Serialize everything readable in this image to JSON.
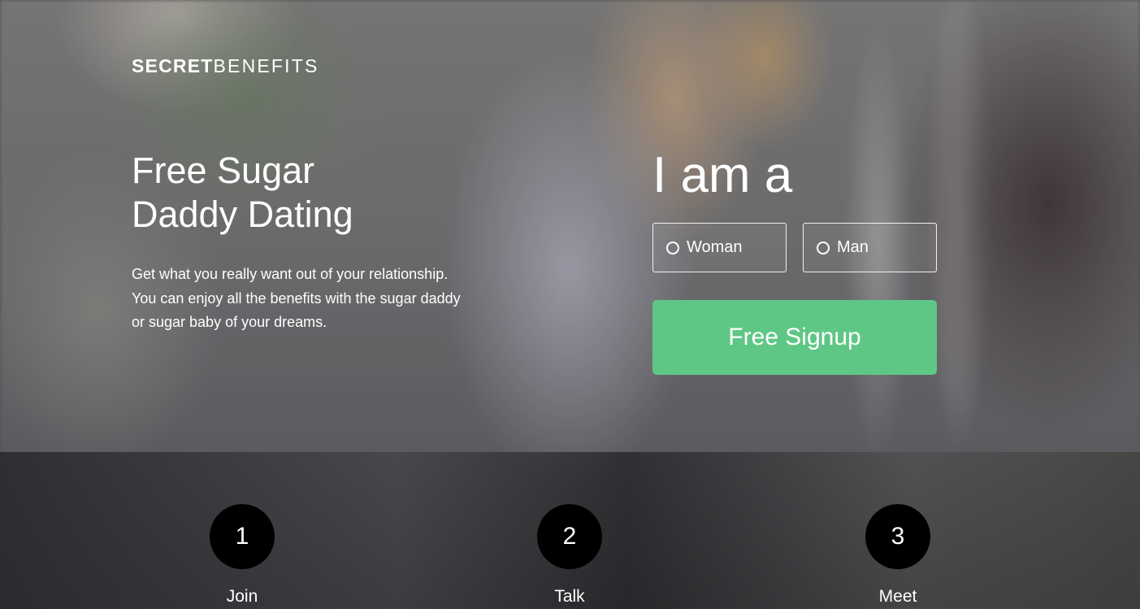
{
  "brand": {
    "logo_bold": "SECRET",
    "logo_light": "BENEFITS"
  },
  "hero": {
    "headline_line1": "Free Sugar",
    "headline_line2": "Daddy Dating",
    "description_line1": "Get what you really want out of your relationship.",
    "description_line2": "You can enjoy all the benefits with the sugar daddy",
    "description_line3": "or sugar baby of your dreams."
  },
  "signup": {
    "prompt": "I am a",
    "options": [
      {
        "label": "Woman",
        "selected": false
      },
      {
        "label": "Man",
        "selected": false
      }
    ],
    "button_label": "Free Signup",
    "button_color": "#5fc786"
  },
  "steps": [
    {
      "number": "1",
      "label": "Join"
    },
    {
      "number": "2",
      "label": "Talk"
    },
    {
      "number": "3",
      "label": "Meet"
    }
  ]
}
